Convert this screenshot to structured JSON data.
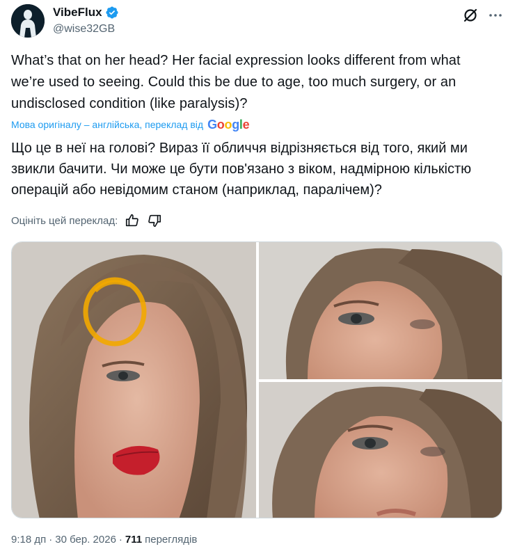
{
  "author": {
    "display_name": "VibeFlux",
    "handle": "@wise32GB",
    "verified": true,
    "avatar_icon": "person-silhouette-avatar"
  },
  "header_actions": {
    "grok_icon": "grok-icon",
    "more_icon": "more-icon"
  },
  "tweet": {
    "text_line_1": "What’s that on her head? Her facial expression looks different from what",
    "text_line_2": "we’re used to seeing. Could this be due to age, too much surgery, or an",
    "text_line_3": "undisclosed condition (like paralysis)?"
  },
  "translation": {
    "label": "Мова оригіналу – англійська, переклад від",
    "provider": "Google",
    "line_1": "Що це в неї на голові? Вираз її обличчя відрізняється від того, який ми",
    "line_2": "звикли бачити. Чи може це бути пов'язано з віком, надмірною кількістю",
    "line_3": "операцій або невідомим станом (наприклад, паралічем)?",
    "rate_label": "Оцініть цей переклад:"
  },
  "media": {
    "photos": [
      {
        "label": "photo-1",
        "description_icon": "face-photo-with-highlight-circle"
      },
      {
        "label": "photo-2",
        "description_icon": "face-closeup-eyes"
      },
      {
        "label": "photo-3",
        "description_icon": "face-closeup-eyes-2"
      }
    ],
    "highlight_color": "#f2a900"
  },
  "meta": {
    "time": "9:18 дп",
    "separator": "·",
    "date": "30 бер. 2026",
    "separator_2": "·",
    "views_count": "711",
    "views_label": "переглядів"
  },
  "colors": {
    "accent": "#1d9bf0",
    "text_primary": "#0f1419",
    "text_secondary": "#536471"
  }
}
